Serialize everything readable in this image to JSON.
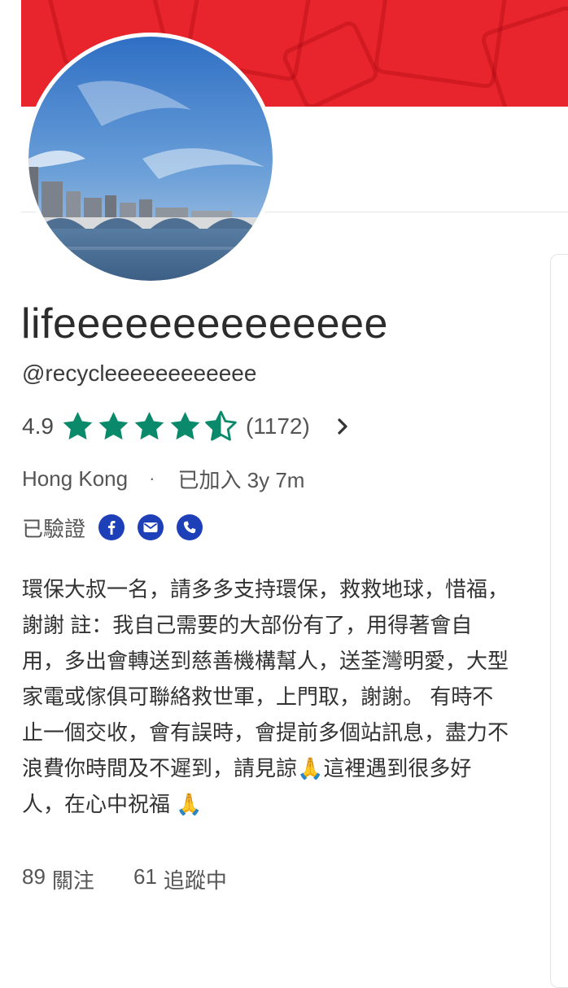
{
  "profile": {
    "display_name": "lifeeeeeeeeeeeeee",
    "username": "@recycleeeeeeeeeeee",
    "rating": "4.9",
    "stars": 4.5,
    "review_count": "(1172)",
    "location": "Hong Kong",
    "separator": "·",
    "joined": "已加入 3y 7m",
    "verified_label": "已驗證",
    "verified_icons": [
      "facebook-icon",
      "email-icon",
      "phone-icon"
    ],
    "bio": "環保大叔一名，請多多支持環保，救救地球，惜福，謝謝 註：我自己需要的大部份有了，用得著會自用，多出會轉送到慈善機構幫人，送荃灣明愛，大型家電或傢俱可聯絡救世軍，上門取，謝謝。 有時不止一個交收，會有誤時，會提前多個站訊息，盡力不浪費你時間及不遲到，請見諒🙏這裡遇到很多好人，在心中祝福 🙏",
    "followers_count": "89",
    "followers_label": "關注",
    "following_count": "61",
    "following_label": "追蹤中"
  },
  "colors": {
    "cover": "#e8242c",
    "star": "#0a8a6a",
    "verified_badge": "#1d3fb8"
  }
}
